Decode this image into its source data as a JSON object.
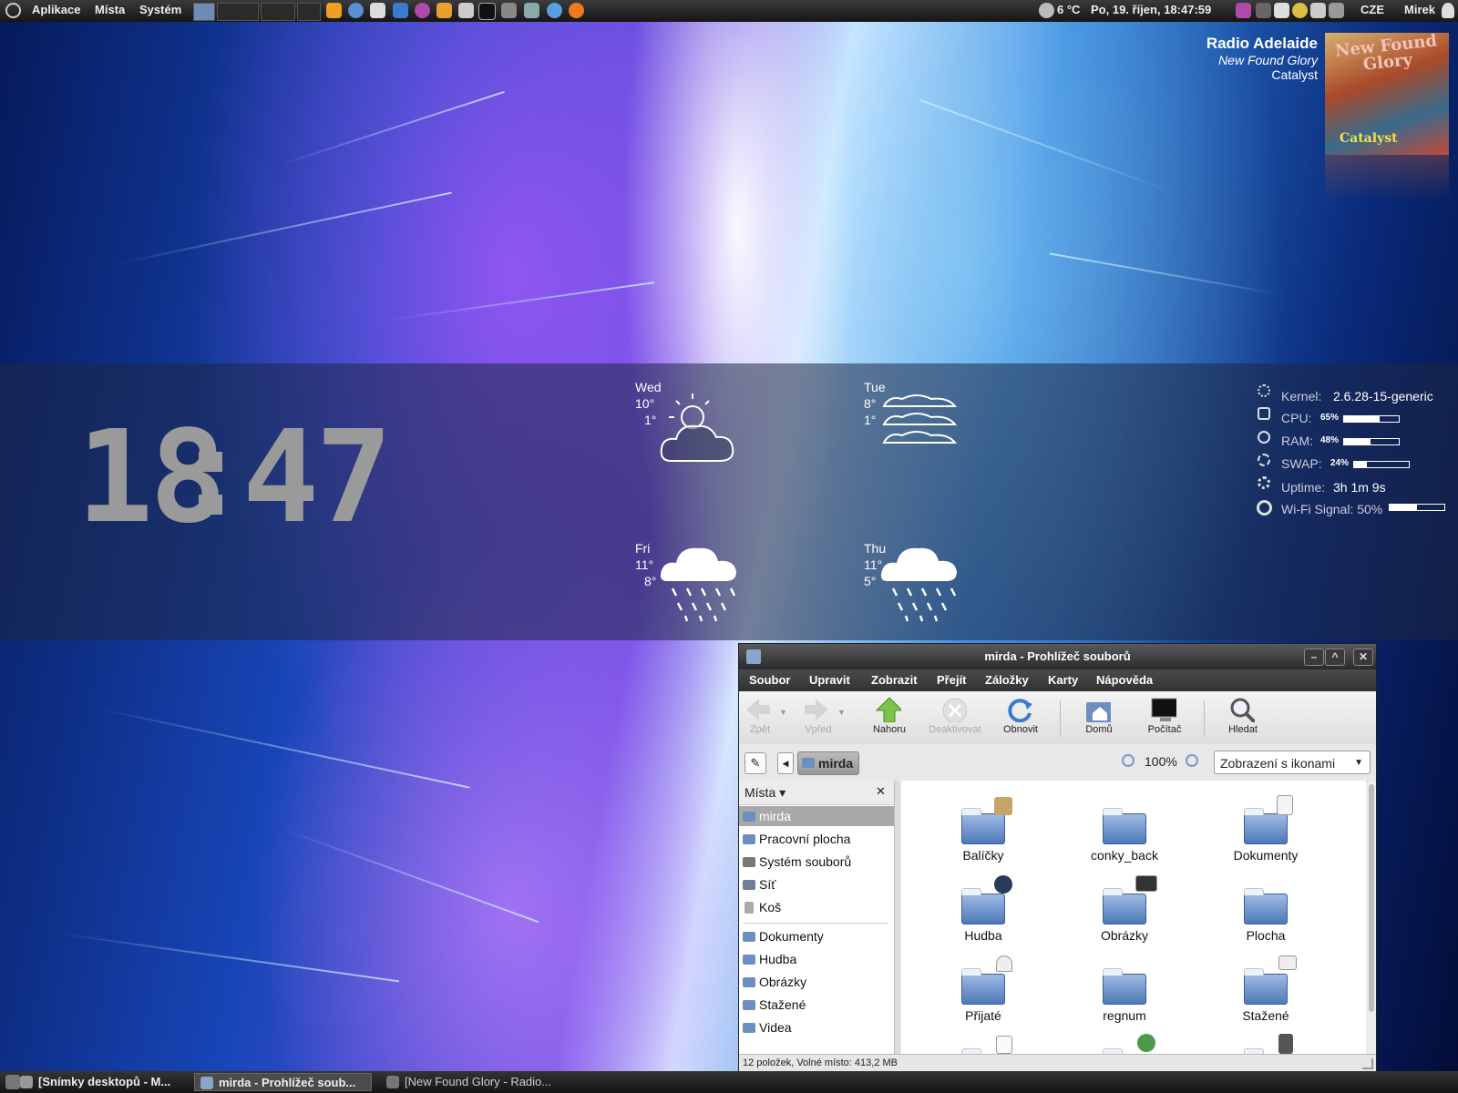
{
  "top_panel": {
    "menus": [
      "Aplikace",
      "Místa",
      "Systém"
    ],
    "weather": "6 °C",
    "datetime": "Po, 19. říjen, 18:47:59",
    "keyboard": "CZE",
    "user": "Mirek"
  },
  "now_playing": {
    "station": "Radio Adelaide",
    "artist": "New Found Glory",
    "album": "Catalyst",
    "cover_text": "New Found Glory",
    "cover_sub": "Catalyst"
  },
  "clock": {
    "hours": "18",
    "minutes": "47"
  },
  "weather_forecast": [
    {
      "day": "Wed",
      "high": "10°",
      "low": "1°",
      "icon": "partly-cloudy-icon"
    },
    {
      "day": "Tue",
      "high": "8°",
      "low": "1°",
      "icon": "fog-icon"
    },
    {
      "day": "Fri",
      "high": "11°",
      "low": "8°",
      "icon": "rain-icon"
    },
    {
      "day": "Thu",
      "high": "11°",
      "low": "5°",
      "icon": "rain-icon"
    }
  ],
  "system": {
    "kernel_label": "Kernel:",
    "kernel": "2.6.28-15-generic",
    "cpu_label": "CPU:",
    "cpu": "65%",
    "cpu_frac": 0.65,
    "ram_label": "RAM:",
    "ram": "48%",
    "ram_frac": 0.48,
    "swap_label": "SWAP:",
    "swap": "24%",
    "swap_frac": 0.24,
    "uptime_label": "Uptime:",
    "uptime": "3h 1m 9s",
    "wifi_label": "Wi-Fi Signal: 50%",
    "wifi_frac": 0.5
  },
  "file_manager": {
    "title": "mirda - Prohlížeč souborů",
    "menu": [
      "Soubor",
      "Upravit",
      "Zobrazit",
      "Přejít",
      "Záložky",
      "Karty",
      "Nápověda"
    ],
    "toolbar": {
      "back": "Zpět",
      "forward": "Vpřed",
      "up": "Nahoru",
      "stop": "Deaktivovat",
      "reload": "Obnovit",
      "home": "Domů",
      "computer": "Počítač",
      "search": "Hledat"
    },
    "location": "mirda",
    "zoom": "100%",
    "view_mode": "Zobrazení s ikonami",
    "sidebar_title": "Místa ▾",
    "places": [
      "mirda",
      "Pracovní plocha",
      "Systém souborů",
      "Síť",
      "Koš"
    ],
    "bookmarks": [
      "Dokumenty",
      "Hudba",
      "Obrázky",
      "Stažené",
      "Videa"
    ],
    "folders": [
      "Balíčky",
      "conky_back",
      "Dokumenty",
      "Hudba",
      "Obrázky",
      "Plocha",
      "Přijaté",
      "regnum",
      "Stažené"
    ],
    "status": "12 položek, Volné místo: 413,2 MB"
  },
  "taskbar": [
    "[Snímky desktopů - M...",
    "mirda - Prohlížeč soub...",
    "[New Found Glory - Radio..."
  ],
  "colors": {
    "folder": "#4d78b8",
    "clock": "#9a9a9a",
    "panel": "#1e1e1e"
  }
}
